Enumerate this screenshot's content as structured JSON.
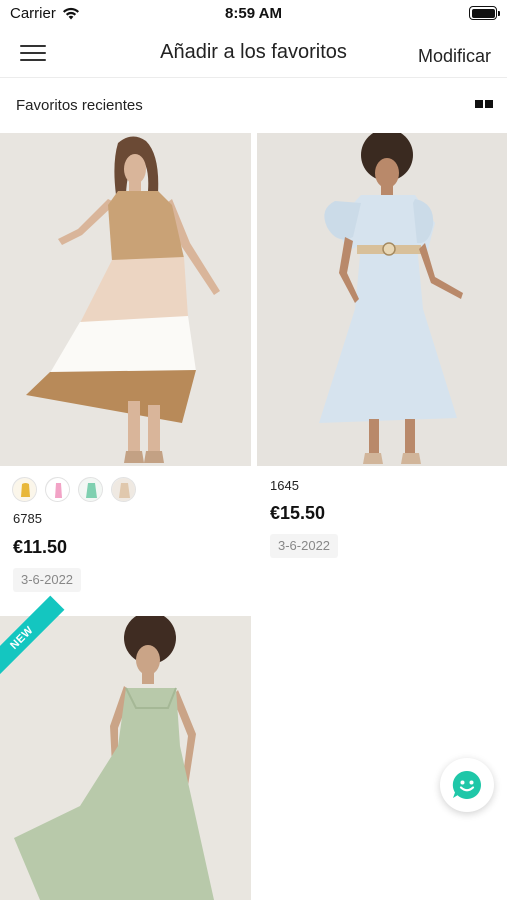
{
  "status_bar": {
    "carrier": "Carrier",
    "time": "8:59 AM",
    "icons": [
      "wifi-icon",
      "battery-icon"
    ]
  },
  "nav": {
    "title": "Añadir a los favoritos",
    "edit_label": "Modificar",
    "menu_icon": "hamburger-menu-icon"
  },
  "section": {
    "title": "Favoritos recientes",
    "view_icon": "grid-view-icon"
  },
  "products": [
    {
      "code": "6785",
      "price": "€11.50",
      "date": "3-6-2022",
      "swatches": [
        "swatch-color-1",
        "swatch-color-2",
        "swatch-color-3",
        "swatch-color-4"
      ],
      "image": "tiered-dress-photo"
    },
    {
      "code": "1645",
      "price": "€15.50",
      "date": "3-6-2022",
      "swatches": [],
      "image": "light-blue-shirt-dress-photo"
    },
    {
      "badge": "NEW",
      "image": "sage-slip-dress-photo"
    }
  ],
  "chat_button": {
    "icon": "chat-smile-icon"
  },
  "colors": {
    "accent": "#14c6c0",
    "chat": "#1fc7a8",
    "text": "#222222",
    "date_bg": "#f4f4f4"
  }
}
